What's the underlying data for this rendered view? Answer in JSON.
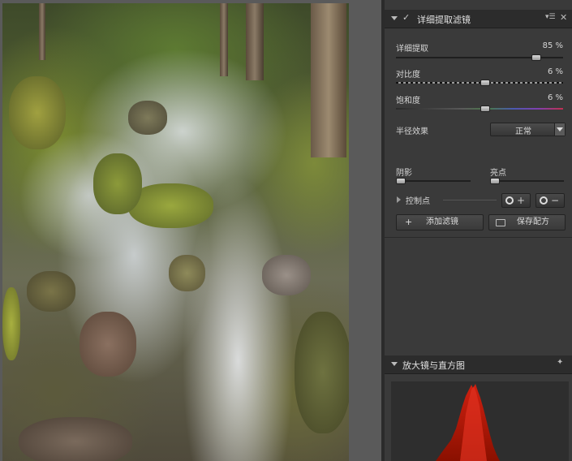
{
  "filter_panel": {
    "title": "详细提取滤镜",
    "sliders": [
      {
        "label": "详细提取",
        "value_text": "85 %",
        "value": 85
      },
      {
        "label": "对比度",
        "value_text": "6 %",
        "value": 6
      },
      {
        "label": "饱和度",
        "value_text": "6 %",
        "value": 6
      }
    ],
    "radius_effect": {
      "label": "半径效果",
      "selected": "正常"
    },
    "shadows_label": "阴影",
    "highlights_label": "亮点",
    "control_points_label": "控制点",
    "add_filter_label": "添加滤镜",
    "save_recipe_label": "保存配方",
    "add_glyph": "+",
    "minus_glyph": "−"
  },
  "loupe_panel": {
    "title": "放大镜与直方图"
  },
  "colors": {
    "panel_bg": "#3a3a3a",
    "header_bg": "#2c2c2c",
    "histogram_red": "#c01a00"
  }
}
